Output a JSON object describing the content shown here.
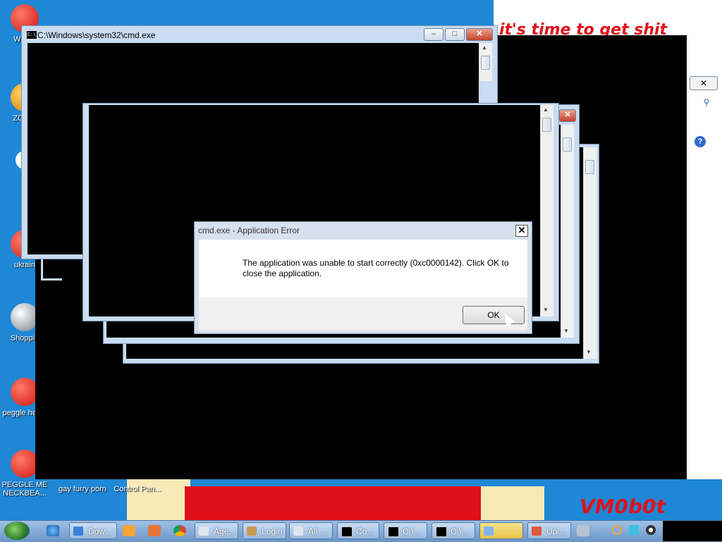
{
  "desktop": {
    "background_text": "it's time to get shit",
    "corner_logo": "VM0b0t",
    "icons": [
      {
        "label": "WIN V",
        "glyph": "app-red"
      },
      {
        "label": "ZO DE",
        "glyph": "app-orange"
      },
      {
        "label": "",
        "glyph": "flower"
      },
      {
        "label": "ukrain",
        "glyph": "app-red"
      },
      {
        "label": "Shoppin",
        "glyph": "flash"
      },
      {
        "label": "peggle heggl",
        "glyph": "peggle"
      },
      {
        "label": "PEGGLE ME NECKBEA...",
        "glyph": "peggle"
      },
      {
        "label": "gay furry porn",
        "glyph": "file"
      },
      {
        "label": "Control Pan...",
        "glyph": "control-panel"
      }
    ]
  },
  "cmd_window": {
    "title": "C:\\Windows\\system32\\cmd.exe",
    "minimize": "–",
    "maximize": "□",
    "close": "✕"
  },
  "bg_window": {
    "close": "✕",
    "search_icon": "search-icon",
    "help": "?"
  },
  "dialog": {
    "title": "cmd.exe - Application Error",
    "close": "✕",
    "message": "The application was unable to start correctly (0xc0000142). Click OK to close the application.",
    "ok_label": "OK"
  },
  "taskbar": {
    "buttons": [
      {
        "label": "Dow...",
        "icon": "browser-icon",
        "color": "#3d7fd6"
      },
      {
        "label": "Age...",
        "icon": "window-icon",
        "color": "#dfe6ef"
      },
      {
        "label": "Login",
        "icon": "avatar-icon",
        "color": "#c99a52"
      },
      {
        "label": "All ...",
        "icon": "window-icon",
        "color": "#dfe6ef"
      },
      {
        "label": "Co...",
        "icon": "cmd-icon",
        "color": "#000000"
      },
      {
        "label": "C:\\...",
        "icon": "cmd-icon",
        "color": "#000000"
      },
      {
        "label": "C:\\...",
        "icon": "cmd-icon",
        "color": "#000000"
      },
      {
        "label": "",
        "icon": "control-panel-icon",
        "color": "#7fb5e8"
      },
      {
        "label": "Upl...",
        "icon": "paint-icon",
        "color": "#e05a3a"
      }
    ]
  }
}
